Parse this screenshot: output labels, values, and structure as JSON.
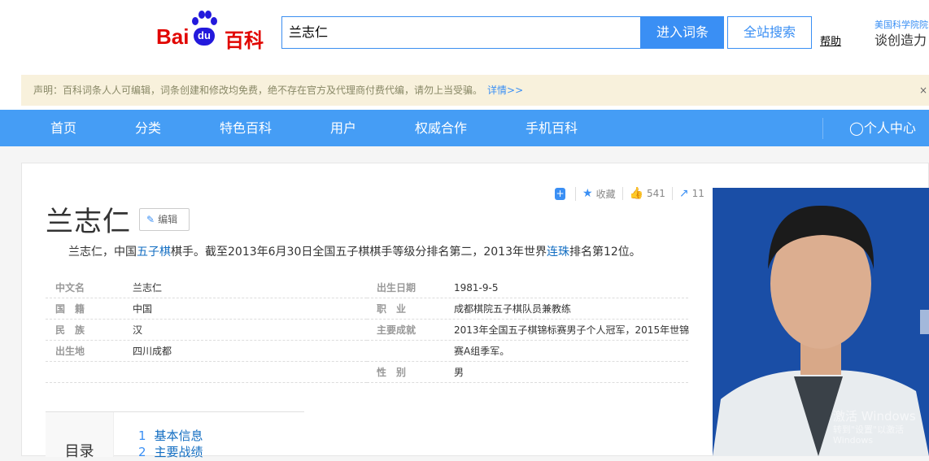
{
  "header": {
    "logo_text": "Baidu百科",
    "logo_bai": "Bai",
    "logo_du": "du",
    "logo_baike": "百科",
    "search_value": "兰志仁",
    "enter_label": "进入词条",
    "all_search_label": "全站搜索",
    "help_label": "帮助",
    "ad_line1": "美国科学院院",
    "ad_line2": "谈创造力"
  },
  "notice": {
    "text": "声明：百科词条人人可编辑，词条创建和修改均免费，绝不存在官方及代理商付费代编，请勿上当受骗。",
    "link": "详情>>",
    "close": "×"
  },
  "nav": {
    "items": [
      "首页",
      "分类",
      "特色百科",
      "用户",
      "权威合作",
      "手机百科"
    ],
    "user_center": "个人中心"
  },
  "entry": {
    "title": "兰志仁",
    "edit_label": "编辑",
    "collect_label": "收藏",
    "likes": "541",
    "shares": "11",
    "summary": {
      "p1": "兰志仁，中国",
      "link1": "五子棋",
      "p2": "棋手。截至2013年6月30日全国五子棋棋手等级分排名第二，2013年世界",
      "link2": "连珠",
      "p3": "排名第12位。"
    },
    "info_left": [
      {
        "k": "中文名",
        "v": "兰志仁"
      },
      {
        "k": "国　籍",
        "v": "中国"
      },
      {
        "k": "民　族",
        "v": "汉"
      },
      {
        "k": "出生地",
        "v": "四川成都"
      }
    ],
    "info_right": [
      {
        "k": "出生日期",
        "v": "1981-9-5"
      },
      {
        "k": "职　业",
        "v": "成都棋院五子棋队员兼教练"
      },
      {
        "k": "主要成就",
        "v": "2013年全国五子棋锦标赛男子个人冠军，2015年世锦"
      },
      {
        "k": "",
        "v": "赛A组季军。"
      },
      {
        "k": "性　别",
        "v": "男"
      }
    ]
  },
  "toc": {
    "label": "目录",
    "items": [
      {
        "n": "1",
        "t": "基本信息"
      },
      {
        "n": "2",
        "t": "主要战绩"
      }
    ]
  },
  "watermark": {
    "line1": "激活 Windows",
    "line2": "转到\"设置\"以激活 Windows"
  }
}
